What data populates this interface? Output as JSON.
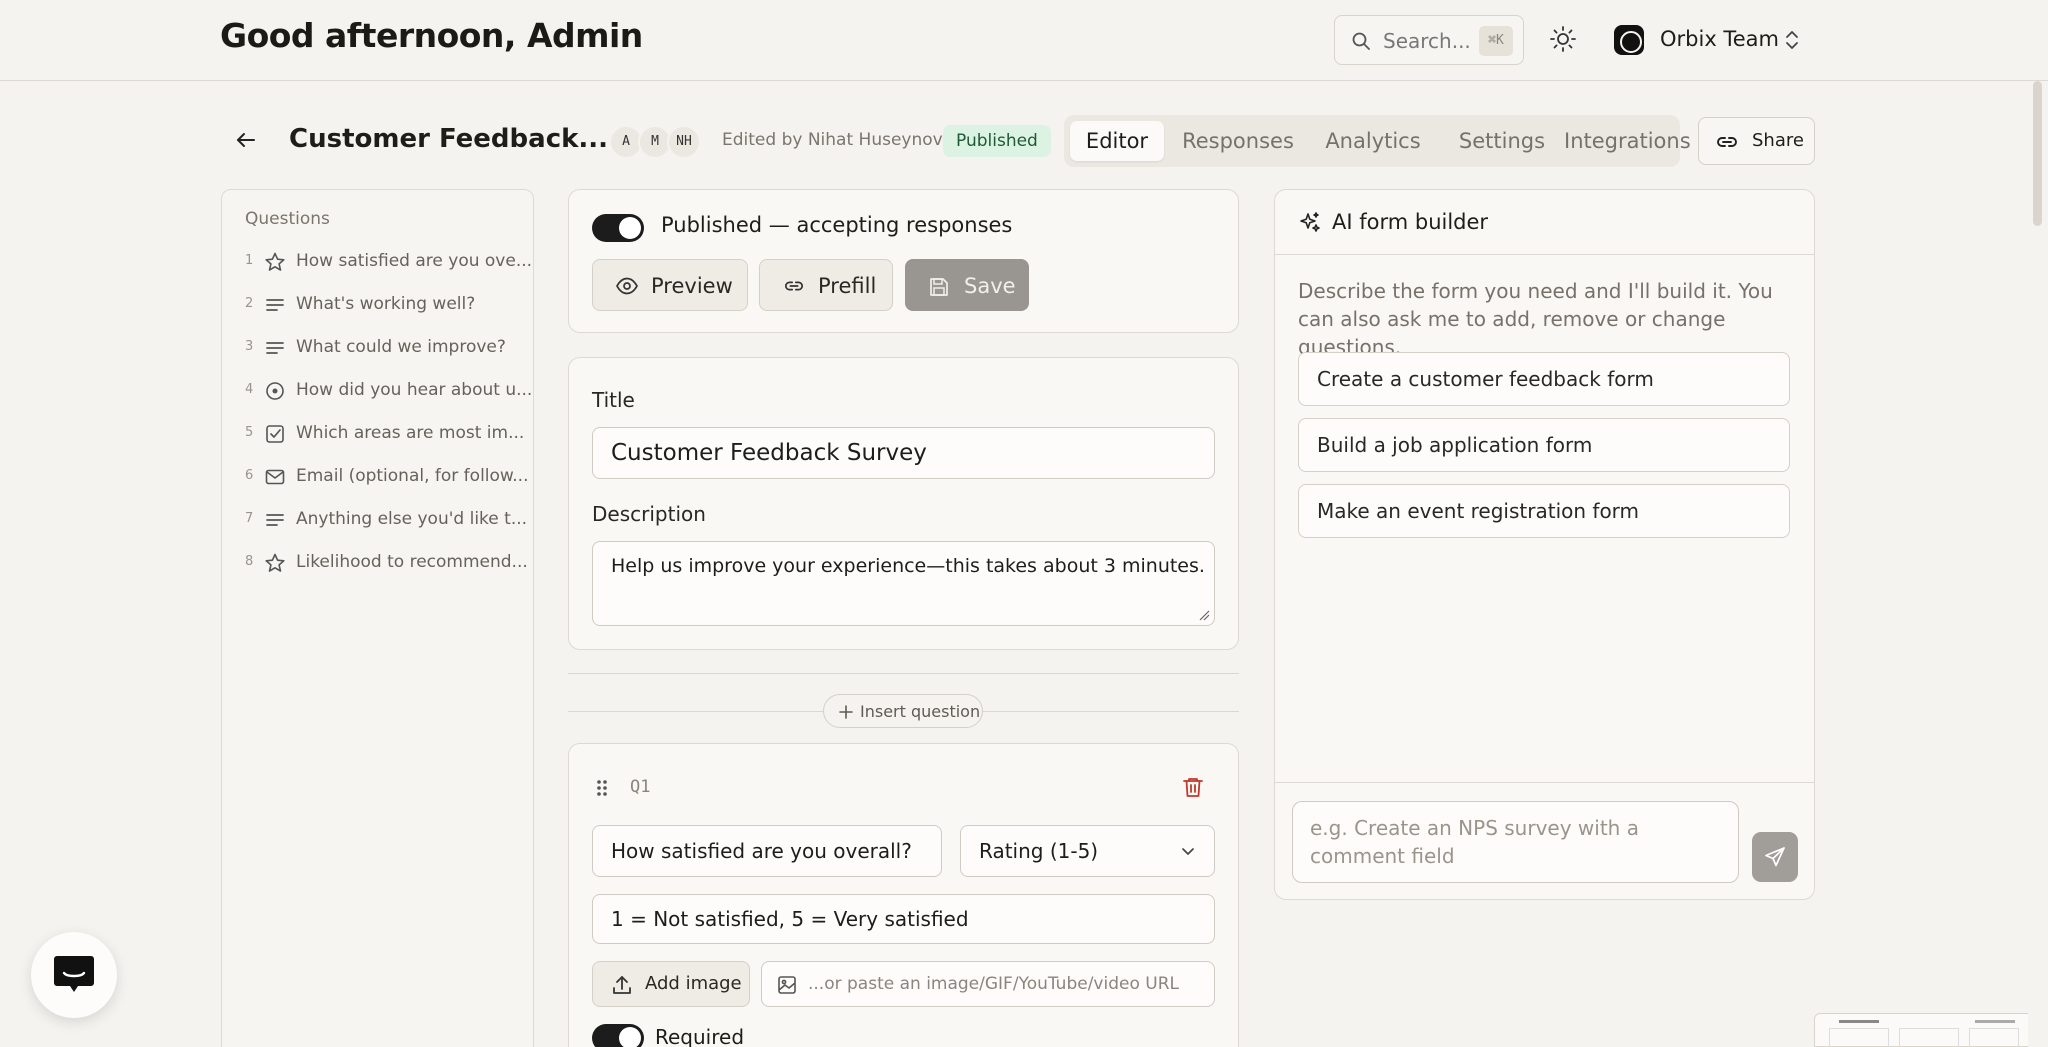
{
  "header": {
    "greeting": "Good afternoon, Admin",
    "search_placeholder": "Search...",
    "search_shortcut": "⌘K",
    "team_name": "Orbix Team"
  },
  "form_header": {
    "title": "Customer Feedback...",
    "avatars": [
      "A",
      "M",
      "NH"
    ],
    "edited_by": "Edited by Nihat Huseynov",
    "status_badge": "Published",
    "tabs": [
      "Editor",
      "Responses",
      "Analytics",
      "Settings",
      "Integrations"
    ],
    "active_tab": "Editor",
    "share_label": "Share"
  },
  "questions_panel": {
    "heading": "Questions",
    "items": [
      {
        "num": "1",
        "icon": "star-icon",
        "label": "How satisfied are you ove..."
      },
      {
        "num": "2",
        "icon": "text-lines-icon",
        "label": "What's working well?"
      },
      {
        "num": "3",
        "icon": "text-lines-icon",
        "label": "What could we improve?"
      },
      {
        "num": "4",
        "icon": "radio-icon",
        "label": "How did you hear about u..."
      },
      {
        "num": "5",
        "icon": "checkbox-icon",
        "label": "Which areas are most im..."
      },
      {
        "num": "6",
        "icon": "mail-icon",
        "label": "Email (optional, for follow..."
      },
      {
        "num": "7",
        "icon": "text-lines-icon",
        "label": "Anything else you'd like t..."
      },
      {
        "num": "8",
        "icon": "star-icon",
        "label": "Likelihood to recommend..."
      }
    ]
  },
  "publish_card": {
    "toggle_label": "Published — accepting responses",
    "toggle_on": true,
    "preview_label": "Preview",
    "prefill_label": "Prefill",
    "save_label": "Save"
  },
  "form_meta": {
    "title_label": "Title",
    "title_value": "Customer Feedback Survey",
    "description_label": "Description",
    "description_value": "Help us improve your experience—this takes about 3 minutes."
  },
  "insert_question_label": "Insert question",
  "question_1": {
    "tag": "Q1",
    "question_text": "How satisfied are you overall?",
    "type": "Rating (1-5)",
    "help_text": "1 = Not satisfied, 5 = Very satisfied",
    "add_image_label": "Add image",
    "media_placeholder": "...or paste an image/GIF/YouTube/video URL",
    "required_label": "Required",
    "required_on": true
  },
  "ai_builder": {
    "title": "AI form builder",
    "description": "Describe the form you need and I'll build it. You can also ask me to add, remove or change questions.",
    "suggestions": [
      "Create a customer feedback form",
      "Build a job application form",
      "Make an event registration form"
    ],
    "input_placeholder": "e.g. Create an NPS survey with a comment field"
  },
  "colors": {
    "background": "#f5f3ef",
    "published_badge_bg": "#dcf3e4",
    "published_badge_text": "#1e5a36",
    "toggle_on": "#1c1c1c",
    "delete_icon": "#c0392b"
  }
}
